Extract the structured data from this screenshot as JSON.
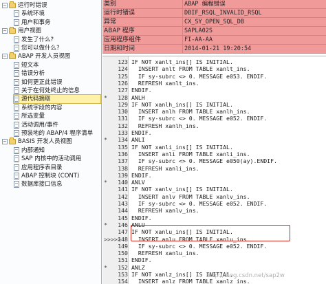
{
  "tree": {
    "items": [
      {
        "label": "运行时错误",
        "level": 0,
        "kind": "folder",
        "expanded": true
      },
      {
        "label": "系统环境",
        "level": 1,
        "kind": "doc"
      },
      {
        "label": "用户和事务",
        "level": 1,
        "kind": "doc"
      },
      {
        "label": "用户视图",
        "level": 0,
        "kind": "folder",
        "expanded": true
      },
      {
        "label": "发生了什么?",
        "level": 1,
        "kind": "doc"
      },
      {
        "label": "您可以做什么?",
        "level": 1,
        "kind": "doc"
      },
      {
        "label": "ABAP 开发人员视图",
        "level": 0,
        "kind": "folder",
        "expanded": true
      },
      {
        "label": "短文本",
        "level": 1,
        "kind": "doc"
      },
      {
        "label": "错误分析",
        "level": 1,
        "kind": "doc"
      },
      {
        "label": "如何更正此错误",
        "level": 1,
        "kind": "doc"
      },
      {
        "label": "关于在何处终止的信息",
        "level": 1,
        "kind": "doc"
      },
      {
        "label": "源代码摘取",
        "level": 1,
        "kind": "doc",
        "selected": true
      },
      {
        "label": "系统字段的内容",
        "level": 1,
        "kind": "doc"
      },
      {
        "label": "所选变量",
        "level": 1,
        "kind": "doc"
      },
      {
        "label": "活动调用/事件",
        "level": 1,
        "kind": "doc"
      },
      {
        "label": "预装地的 ABAP/4 程序清单",
        "level": 1,
        "kind": "doc"
      },
      {
        "label": "BASIS 开发人员视图",
        "level": 0,
        "kind": "folder",
        "expanded": true
      },
      {
        "label": "内部通知",
        "level": 1,
        "kind": "doc"
      },
      {
        "label": "SAP 内核中的活动调用",
        "level": 1,
        "kind": "doc"
      },
      {
        "label": "应用程序表目录",
        "level": 1,
        "kind": "doc"
      },
      {
        "label": "ABAP 控制块 (CONT)",
        "level": 1,
        "kind": "doc"
      },
      {
        "label": "数据库接口信息",
        "level": 1,
        "kind": "doc"
      }
    ]
  },
  "info": {
    "rows": [
      {
        "key": "类别",
        "value": "ABAP 编程错误"
      },
      {
        "key": "运行时错误",
        "value": "DBIF_RSQL_INVALID_RSQL"
      },
      {
        "key": "异常",
        "value": "CX_SY_OPEN_SQL_DB"
      },
      {
        "key": "ABAP 程序",
        "value": "SAPLA02S"
      },
      {
        "key": "应用程序组件",
        "value": "FI-AA-AA"
      },
      {
        "key": "日期和时间",
        "value": "2014-01-21  19:20:54"
      }
    ]
  },
  "code": {
    "lines": [
      {
        "num": "123",
        "mark": "",
        "text": "IF NOT xanlt_ins[] IS INITIAL."
      },
      {
        "num": "124",
        "mark": "",
        "text": "  INSERT anlt FROM TABLE xanlt_ins."
      },
      {
        "num": "125",
        "mark": "",
        "text": "  IF sy-subrc <> 0. MESSAGE e053. ENDIF."
      },
      {
        "num": "126",
        "mark": "",
        "text": "  REFRESH xanlt_ins."
      },
      {
        "num": "127",
        "mark": "",
        "text": "ENDIF."
      },
      {
        "num": "128",
        "mark": "*",
        "text": "ANLH"
      },
      {
        "num": "129",
        "mark": "",
        "text": "IF NOT xanlh_ins[] IS INITIAL."
      },
      {
        "num": "130",
        "mark": "",
        "text": "  INSERT anlh FROM TABLE xanlh_ins."
      },
      {
        "num": "131",
        "mark": "",
        "text": "  IF sy-subrc <> 0. MESSAGE e052. ENDIF."
      },
      {
        "num": "132",
        "mark": "",
        "text": "  REFRESH xanlh_ins."
      },
      {
        "num": "133",
        "mark": "",
        "text": "ENDIF."
      },
      {
        "num": "134",
        "mark": "*",
        "text": "ANLI"
      },
      {
        "num": "135",
        "mark": "",
        "text": "IF NOT xanli_ins[] IS INITIAL."
      },
      {
        "num": "136",
        "mark": "",
        "text": "  INSERT anli FROM TABLE xanli_ins."
      },
      {
        "num": "137",
        "mark": "",
        "text": "  IF sy-subrc <> 0. MESSAGE e050(ay).ENDIF."
      },
      {
        "num": "138",
        "mark": "",
        "text": "  REFRESH xanli_ins."
      },
      {
        "num": "139",
        "mark": "",
        "text": "ENDIF."
      },
      {
        "num": "140",
        "mark": "*",
        "text": "ANLV"
      },
      {
        "num": "141",
        "mark": "",
        "text": "IF NOT xanlv_ins[] IS INITIAL."
      },
      {
        "num": "142",
        "mark": "",
        "text": "  INSERT anlv FROM TABLE xanlv_ins."
      },
      {
        "num": "143",
        "mark": "",
        "text": "  IF sy-subrc <> 0. MESSAGE e052. ENDIF."
      },
      {
        "num": "144",
        "mark": "",
        "text": "  REFRESH xanlv_ins."
      },
      {
        "num": "145",
        "mark": "",
        "text": "ENDIF."
      },
      {
        "num": "146",
        "mark": "*",
        "text": "ANLU"
      },
      {
        "num": "147",
        "mark": "",
        "text": "IF NOT xanlu_ins[] IS INITIAL."
      },
      {
        "num": "148",
        "mark": ">>>>>",
        "text": "  INSERT anlu FROM TABLE xanlu_ins."
      },
      {
        "num": "149",
        "mark": "",
        "text": "  IF sy-subrc <> 0. MESSAGE e052. ENDIF."
      },
      {
        "num": "150",
        "mark": "",
        "text": "  REFRESH xanlu_ins."
      },
      {
        "num": "151",
        "mark": "",
        "text": "ENDIF."
      },
      {
        "num": "152",
        "mark": "*",
        "text": "ANLZ"
      },
      {
        "num": "153",
        "mark": "",
        "text": "IF NOT xanlz_ins[] IS INITIAL."
      },
      {
        "num": "154",
        "mark": "",
        "text": "  INSERT anlz FROM TABLE xanlz_ins."
      }
    ]
  },
  "watermark": "http://blog.csdn.net/sap2w",
  "colors": {
    "info_bg": "#f09a9a",
    "highlight": "#d0281c",
    "selected": "#fff2a8"
  }
}
